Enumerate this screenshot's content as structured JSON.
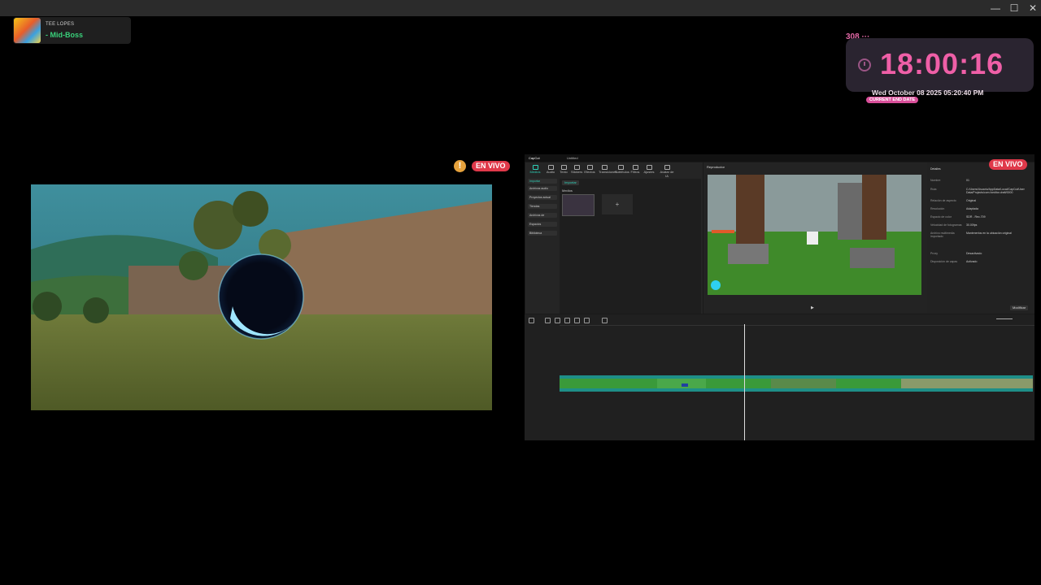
{
  "now_playing": {
    "artist": "TEE LOPES",
    "title": "- Mid-Boss"
  },
  "window_controls": {
    "minimize": "—",
    "maximize": "☐",
    "close": "✕"
  },
  "clock": {
    "counter": "308 ···",
    "time": "18:00:16",
    "date": "Wed October 08 2025 05:20:40 PM",
    "badge": "CURRENT END DATE"
  },
  "live_badge": "EN VIVO",
  "warning_symbol": "!",
  "capcut": {
    "app_name": "CapCut",
    "project_title": "Untitled",
    "toolbar_tabs": [
      "Medios",
      "Audio",
      "Texto",
      "Stickers",
      "Efectos",
      "Transiciones",
      "Subtítulos",
      "Filtros",
      "Ajustes",
      "Avatar de IA"
    ],
    "media_sidebar": [
      "Importar",
      "Archivos audio",
      "Proyectos actual",
      "Tiendas",
      "Archivos de",
      "Espacios",
      "Biblioteca"
    ],
    "media_header": "Medios",
    "import_button": "Importar",
    "player_title": "Reproductor",
    "details_title": "Detalles",
    "details_rows": [
      [
        "Nombre",
        "01"
      ],
      [
        "Ruta",
        "C:/Users/Usuario/AppData/Local/CapCut/User Data/Projects/com.lveditor.draft/0000"
      ],
      [
        "Relación de aspecto",
        "Original"
      ],
      [
        "Resolución",
        "Adaptada"
      ],
      [
        "Espacio de color",
        "SDR - Rec.709"
      ],
      [
        "Velocidad de fotogramas",
        "30.00fps"
      ],
      [
        "Archivo multimedia importado",
        "Mantenerlos en la ubicación original"
      ],
      [
        "Proxy",
        "Desactivado"
      ],
      [
        "Disposición de capas",
        "Activado"
      ]
    ],
    "modify_button": "Modificar"
  },
  "colors": {
    "accent_pink": "#ef5fa7",
    "live_red": "#e0394a",
    "track_teal": "#1e8f88",
    "spotify_green": "#39d07a"
  }
}
